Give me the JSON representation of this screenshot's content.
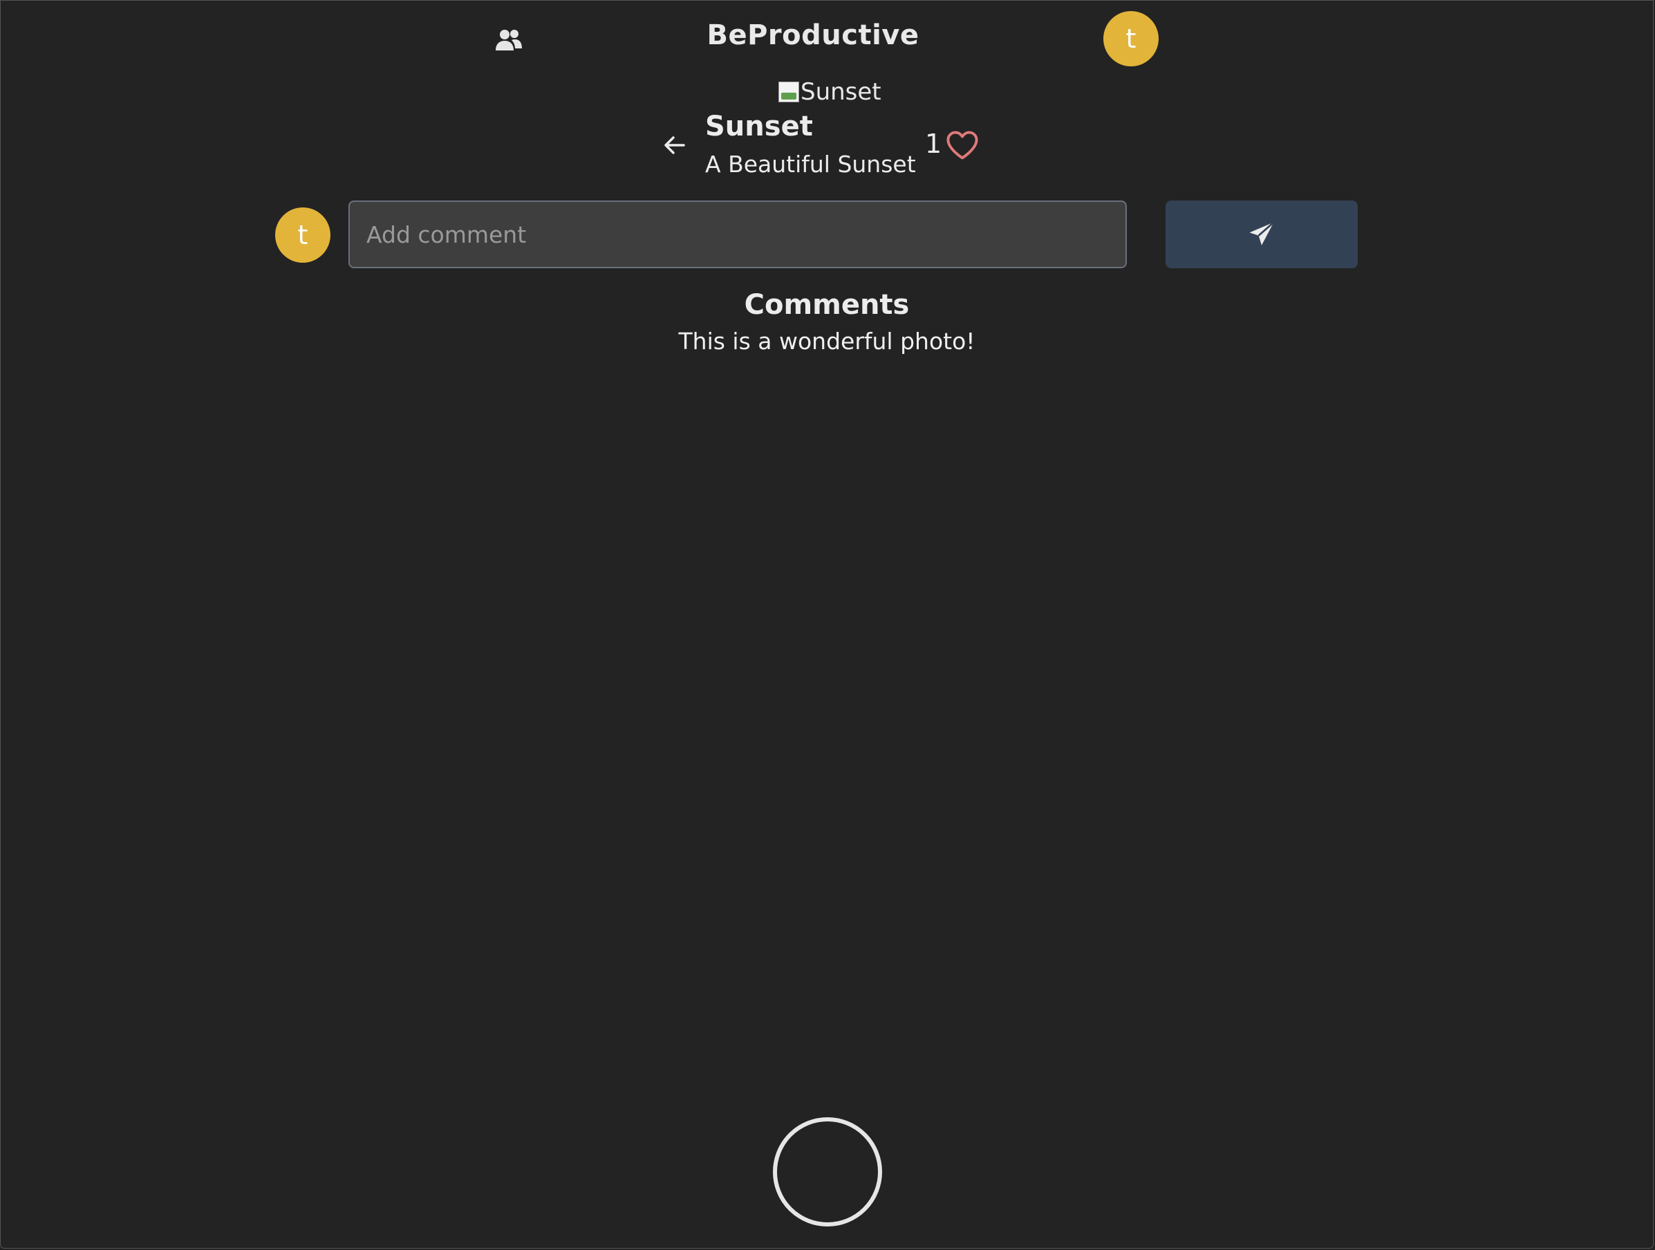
{
  "header": {
    "title": "BeProductive",
    "friends_icon": "users-icon",
    "avatar_initial": "t"
  },
  "photo": {
    "alt": "Sunset",
    "title": "Sunset",
    "description": "A Beautiful Sunset",
    "likes": "1",
    "back_icon": "arrow-left-icon",
    "like_icon": "heart-icon"
  },
  "comment_form": {
    "avatar_initial": "t",
    "placeholder": "Add comment",
    "value": "",
    "send_icon": "paper-plane-icon"
  },
  "comments": {
    "heading": "Comments",
    "items": [
      "This is a wonderful photo!"
    ]
  },
  "footer": {
    "capture_icon": "circle-capture-icon"
  },
  "colors": {
    "background": "#232323",
    "avatar": "#e3b43a",
    "send_button": "#334155",
    "heart": "#e07a7a",
    "input_bg": "#3e3e3e"
  }
}
